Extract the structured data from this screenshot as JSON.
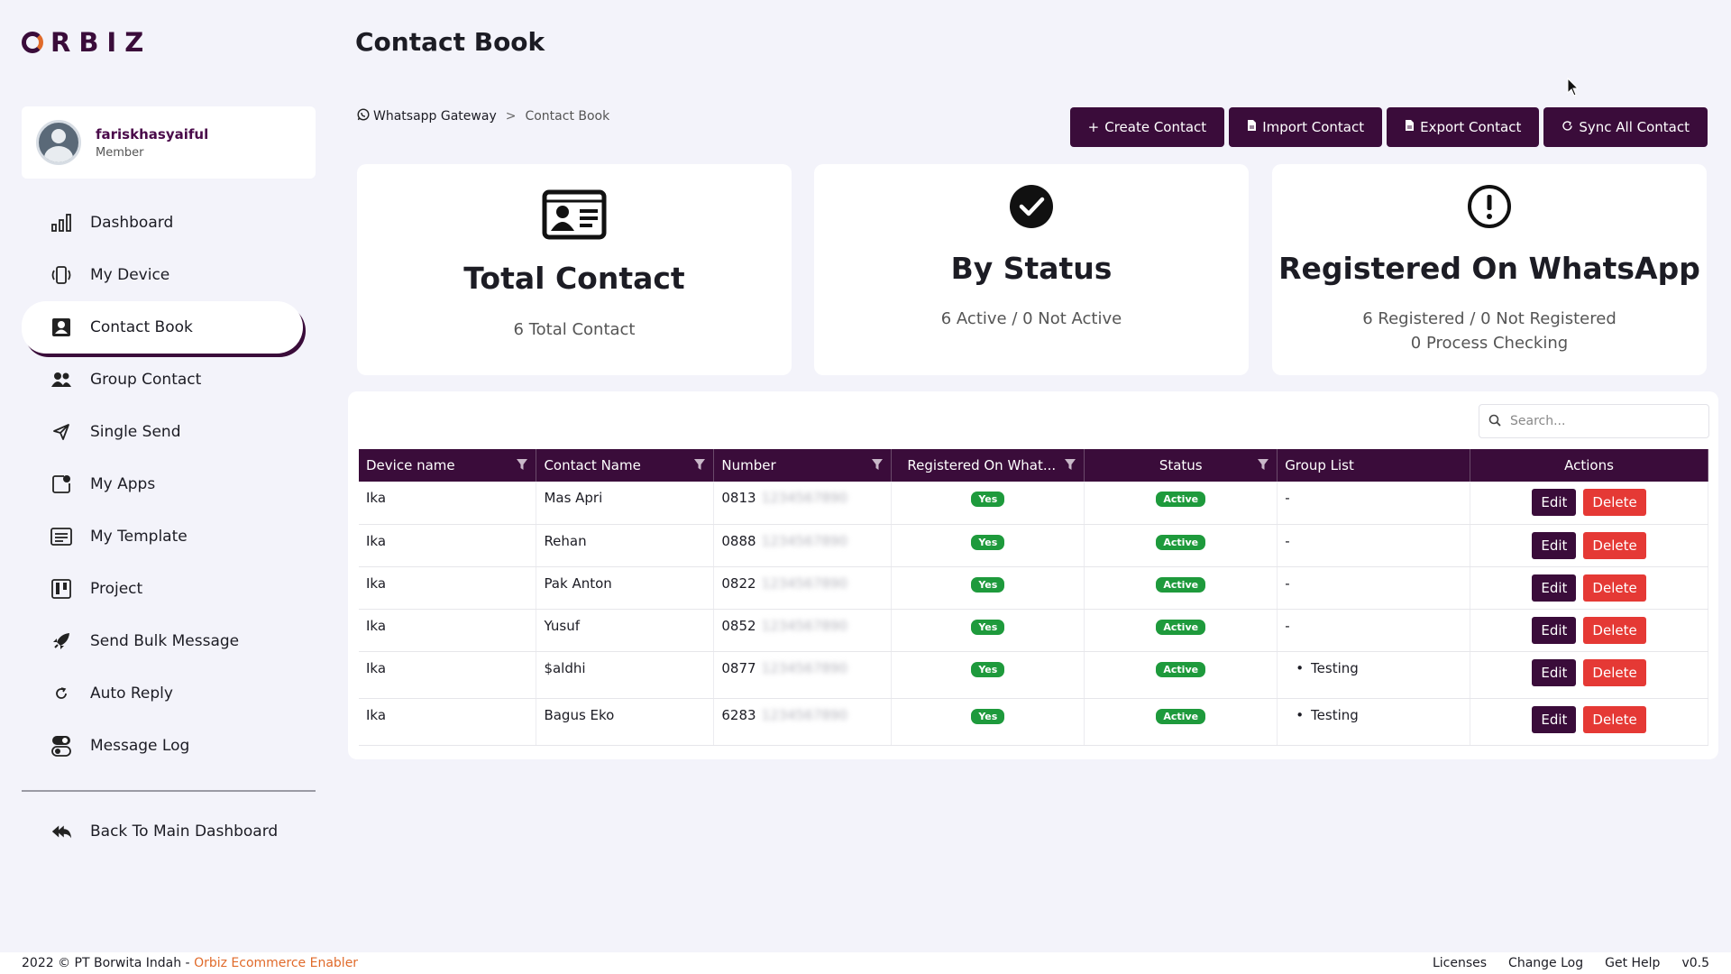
{
  "app": {
    "logo": "RBIZ"
  },
  "user": {
    "name": "fariskhasyaiful",
    "role": "Member"
  },
  "sidebar": {
    "items": [
      {
        "label": "Dashboard",
        "icon": "bar-chart-icon"
      },
      {
        "label": "My Device",
        "icon": "device-icon"
      },
      {
        "label": "Contact Book",
        "icon": "contact-book-icon",
        "active": true
      },
      {
        "label": "Group Contact",
        "icon": "group-icon"
      },
      {
        "label": "Single Send",
        "icon": "send-icon"
      },
      {
        "label": "My Apps",
        "icon": "apps-icon"
      },
      {
        "label": "My Template",
        "icon": "template-icon"
      },
      {
        "label": "Project",
        "icon": "project-icon"
      },
      {
        "label": "Send Bulk Message",
        "icon": "rocket-icon"
      },
      {
        "label": "Auto Reply",
        "icon": "refresh-icon"
      },
      {
        "label": "Message Log",
        "icon": "toggle-icon"
      }
    ],
    "back_label": "Back To Main Dashboard"
  },
  "header": {
    "title": "Contact Book",
    "breadcrumb": {
      "parent": "Whatsapp Gateway",
      "separator": ">",
      "current": "Contact Book"
    }
  },
  "toolbar": {
    "create": "Create Contact",
    "import": "Import Contact",
    "export": "Export Contact",
    "sync": "Sync All Contact"
  },
  "stats": {
    "total": {
      "title": "Total Contact",
      "line1": "6 Total Contact"
    },
    "status": {
      "title": "By Status",
      "line1": "6 Active / 0 Not Active"
    },
    "registered": {
      "title": "Registered On WhatsApp",
      "line1": "6 Registered / 0 Not Registered",
      "line2": "0 Process Checking"
    }
  },
  "search": {
    "placeholder": "Search..."
  },
  "table": {
    "columns": [
      "Device name",
      "Contact Name",
      "Number",
      "Registered On What...",
      "Status",
      "Group List",
      "Actions"
    ],
    "rows": [
      {
        "device": "Ika",
        "name": "Mas Apri",
        "number": "0813",
        "registered": "Yes",
        "status": "Active",
        "group": "-"
      },
      {
        "device": "Ika",
        "name": "Rehan",
        "number": "0888",
        "registered": "Yes",
        "status": "Active",
        "group": "-"
      },
      {
        "device": "Ika",
        "name": "Pak Anton",
        "number": "0822",
        "registered": "Yes",
        "status": "Active",
        "group": "-"
      },
      {
        "device": "Ika",
        "name": "Yusuf",
        "number": "0852",
        "registered": "Yes",
        "status": "Active",
        "group": "-"
      },
      {
        "device": "Ika",
        "name": "$aldhi",
        "number": "0877",
        "registered": "Yes",
        "status": "Active",
        "group": "Testing"
      },
      {
        "device": "Ika",
        "name": "Bagus Eko",
        "number": "6283",
        "registered": "Yes",
        "status": "Active",
        "group": "Testing"
      }
    ],
    "edit_label": "Edit",
    "delete_label": "Delete"
  },
  "footer": {
    "copyright": "2022 © PT Borwita Indah - ",
    "brand": "Orbiz Ecommerce Enabler",
    "links": [
      "Licenses",
      "Change Log",
      "Get Help",
      "v0.5"
    ]
  },
  "colors": {
    "primary": "#3a0c3a",
    "accent": "#e06a2a",
    "success": "#1e9a3c",
    "danger": "#e53935"
  }
}
